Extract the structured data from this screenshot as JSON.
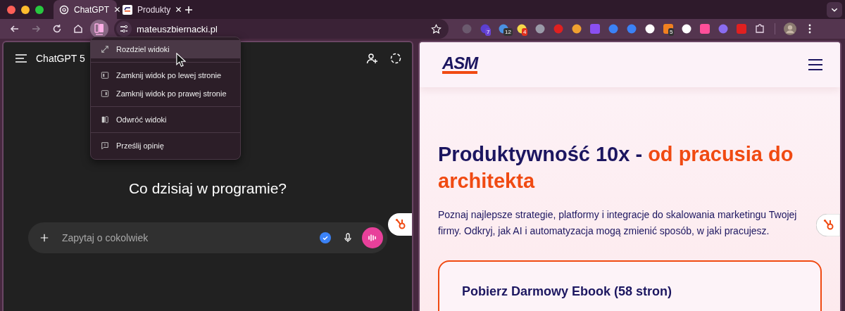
{
  "tabs": [
    {
      "title": "ChatGPT",
      "selected": true,
      "kind": "chatgpt"
    },
    {
      "title": "Produkty",
      "selected": false,
      "kind": "asm"
    }
  ],
  "toolbar": {
    "split_view_active": true,
    "url": "mateuszbiernacki.pl"
  },
  "extensions": [
    {
      "kind": "recycle"
    },
    {
      "kind": "cube",
      "badge": "7"
    },
    {
      "kind": "ghost",
      "badge": "12"
    },
    {
      "kind": "bulbs",
      "badge": "4"
    },
    {
      "kind": "bolt"
    },
    {
      "kind": "hand"
    },
    {
      "kind": "ball"
    },
    {
      "kind": "letter"
    },
    {
      "kind": "dot"
    },
    {
      "kind": "tag"
    },
    {
      "kind": "lt"
    },
    {
      "kind": "fork",
      "badge": "5"
    },
    {
      "kind": "robot"
    },
    {
      "kind": "clickup"
    },
    {
      "kind": "wave"
    },
    {
      "kind": "red"
    },
    {
      "kind": "puzzle"
    }
  ],
  "left_pane": {
    "title": "ChatGPT 5",
    "heading": "Co dzisiaj w programie?",
    "composer": {
      "placeholder": "Zapytaj o cokolwiek"
    }
  },
  "menu": {
    "groups": [
      [
        {
          "label": "Rozdziel widoki",
          "kind": "expand",
          "selected": true
        }
      ],
      [
        {
          "label": "Zamknij widok po lewej stronie",
          "kind": "left",
          "selected": false
        },
        {
          "label": "Zamknij widok po prawej stronie",
          "kind": "right",
          "selected": false
        }
      ],
      [
        {
          "label": "Odwróć widoki",
          "kind": "swap",
          "selected": false
        }
      ],
      [
        {
          "label": "Prześlij opinię",
          "kind": "feedback",
          "selected": false
        }
      ]
    ]
  },
  "right_pane": {
    "logo": "ASM",
    "heading_parts": [
      {
        "text": "Produktywność 10x - ",
        "accent": false
      },
      {
        "text": "od pracusia do architekta",
        "accent": true
      }
    ],
    "intro": "Poznaj najlepsze strategie, platformy i integracje do skalowania marketingu Twojej firmy. Odkryj, jak AI i automatyzacja mogą zmienić sposób, w jaki pracujesz.",
    "card_title": "Pobierz Darmowy Ebook (58 stron)"
  }
}
